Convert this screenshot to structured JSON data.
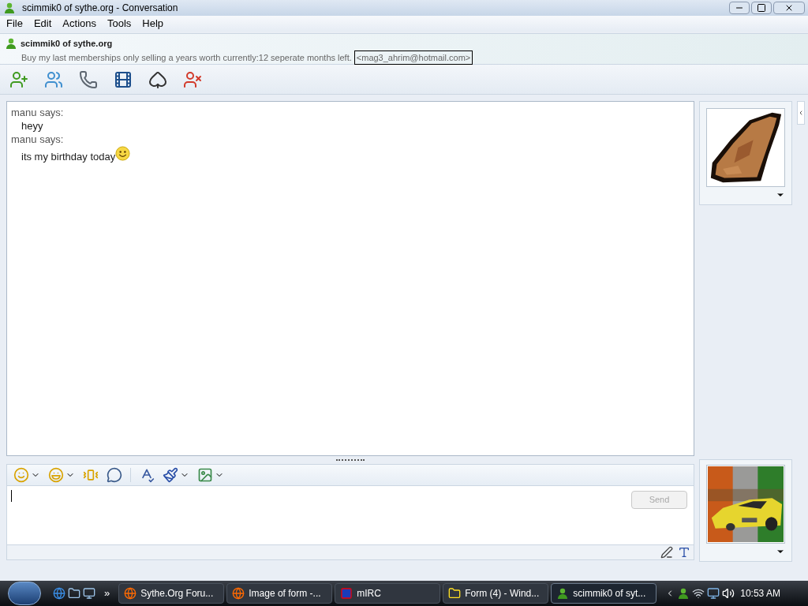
{
  "window": {
    "title": "scimmik0 of sythe.org - Conversation"
  },
  "menu": [
    "File",
    "Edit",
    "Actions",
    "Tools",
    "Help"
  ],
  "contact": {
    "name": "scimmik0 of sythe.org",
    "status_message": "Buy my last memberships only selling a years worth currently:12 seperate months left.",
    "email": "<mag3_ahrim@hotmail.com>"
  },
  "messages": [
    {
      "sender_line": "manu says:",
      "text": "heyy",
      "has_emoticon": false
    },
    {
      "sender_line": "manu says:",
      "text": "its my birthday today",
      "has_emoticon": true
    }
  ],
  "compose": {
    "send_button": {
      "label": "Send",
      "disabled": true
    }
  },
  "taskbar": {
    "items": [
      {
        "label": "Sythe.Org Foru...",
        "selected": false
      },
      {
        "label": "Image of form -...",
        "selected": false
      },
      {
        "label": "mIRC",
        "selected": false
      },
      {
        "label": "Form (4) - Wind...",
        "selected": false
      },
      {
        "label": "scimmik0 of syt...",
        "selected": true
      }
    ],
    "overflow": "»",
    "clock": "10:53 AM"
  }
}
